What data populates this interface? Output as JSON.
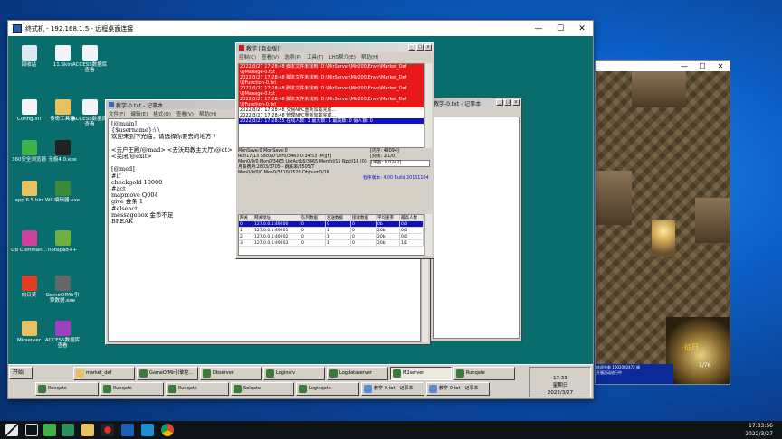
{
  "remote_window": {
    "title": "终式机 - 192.168.1.5 - 远程桌面连接",
    "min": "—",
    "max": "☐",
    "close": "✕"
  },
  "desktop_icons": [
    {
      "label": "回收站",
      "color": "#e0e8f0"
    },
    {
      "label": "11.Skin",
      "color": "#f4f4f4"
    },
    {
      "label": "ACCESS数据库查看",
      "color": "#f4f4f4"
    },
    {
      "label": "Config.ini",
      "color": "#f4f4f4"
    },
    {
      "label": "传奇工具箱",
      "color": "#e8c060"
    },
    {
      "label": "ACCESS数据库查看",
      "color": "#f4f4f4"
    },
    {
      "label": "360安全浏览器",
      "color": "#3fb24a"
    },
    {
      "label": "无极4.0.exe",
      "color": "#222222"
    },
    {
      "label": "app 6.5.bin",
      "color": "#e8c060"
    },
    {
      "label": "WIL编辑器.exe",
      "color": "#3a8a3a"
    },
    {
      "label": "DB Comman...",
      "color": "#d040a0"
    },
    {
      "label": "notepad++",
      "color": "#70b040"
    },
    {
      "label": "向日葵",
      "color": "#e04020"
    },
    {
      "label": "GameOfMir引擎数据.exe",
      "color": "#666666"
    },
    {
      "label": "Mirserver",
      "color": "#e8c060"
    },
    {
      "label": "ACCESS数据库查看",
      "color": "#a040c0"
    }
  ],
  "notepad": {
    "title": "教学-0.txt - 记事本",
    "menu": [
      "文件(F)",
      "编辑(E)",
      "格式(O)",
      "查看(V)",
      "帮助(H)"
    ],
    "content": "[@main]\n{$username}:\\ \\\n欢迎来到下光临，请选择你要去的地方 \\\n\n<去户王殿/@mad> <去沃玛教主大厅/@dt>\n<关闭/@exit>\n\n[@med]\n#if\ncheckgold 10000\n#act\nmapmove Q004\ngive 金条 1\n#elseact\nmessagebox 金币不足\nBREAK"
  },
  "back_window": {
    "title": "教学-0.txt - 记事本"
  },
  "server_window": {
    "title": "教学 [商业版]",
    "menu": [
      "控制(C)",
      "查看(V)",
      "选项(P)",
      "工具(T)",
      "LHS帮介(E)",
      "帮助(H)"
    ],
    "log": [
      {
        "text": "2022/3/27 17:28:48 脚本文件未找到: D:\\MirServer\\Mir200\\Envir\\Market_Def",
        "red": true
      },
      {
        "text": "\\QManage-0.txt",
        "red": true
      },
      {
        "text": "2022/3/27 17:28:48 脚本文件未找到: D:\\MirServer\\Mir200\\Envir\\Market_Def",
        "red": true
      },
      {
        "text": "\\QFunction-0.txt",
        "red": true
      },
      {
        "text": "2022/3/27 17:28:48 脚本文件未找到: D:\\MirServer\\Mir200\\Envir\\Market_Def",
        "red": true
      },
      {
        "text": "\\QManage-0.txt",
        "red": true
      },
      {
        "text": "2022/3/27 17:28:48 脚本文件未找到: D:\\MirServer\\Mir200\\Envir\\Market_Def",
        "red": true
      },
      {
        "text": "\\QFunction-0.txt",
        "red": true
      },
      {
        "text": "2022/3/27 17:28:48 交易NPC重新加载完成...",
        "red": false
      },
      {
        "text": "2022/3/27 17:28:48 管理NPC重新加载完成...",
        "red": false
      },
      {
        "text": "2022/3/27 17:28:55 在线人数: 1 最大数: 1 最高数: 0 假人数: 0",
        "red": false,
        "sel": true
      }
    ],
    "stats": [
      "MonSave:0 MonSave:0",
      "Run17/13 Soc0/0 Usr0/3465          0:34:53 [M][F]",
      "Mon0/0/0 Mon0/3465 UsrAct16/3465 MerchI/15 NpcI/16 (0)",
      "月薪费用:2803/3705 - 跳跃率/3505/T",
      "Mon0/0/0/0 Mon0/3310/3520 Objhum0/16"
    ],
    "right_stats": [
      "[内存: 49094]",
      "[刻线: 1/1/0]",
      "[带宽: 0.0242]"
    ],
    "version": "程序版本: 4.00 Build 20151104",
    "grid_headers": [
      "网关",
      "网关地址",
      "队列数据",
      "发送数据",
      "接收数据",
      "平均速率",
      "最高人数"
    ],
    "grid_rows": [
      [
        "0",
        "127.0.0.1:49200",
        "0",
        "0",
        "0",
        "0b",
        "0/0"
      ],
      [
        "1",
        "127.0.0.1:49201",
        "0",
        "1",
        "0",
        "20b",
        "0/0"
      ],
      [
        "2",
        "127.0.0.1:49202",
        "0",
        "1",
        "0",
        "20b",
        "0/0"
      ],
      [
        "3",
        "127.0.0.1:49203",
        "0",
        "1",
        "0",
        "20b",
        "1/1"
      ]
    ]
  },
  "inner_taskbar": {
    "start": "开始",
    "row1": [
      "market_def",
      "GameOfMir引擎控...",
      "Dbserver",
      "Loginsrv",
      "Logdataserver",
      "M2server",
      "Runqate"
    ],
    "row2": [
      "Runqate",
      "Runqate",
      "Runqate",
      "Selqate",
      "Loginqate",
      "教学-0.txt - 记事本",
      "教学-0.txt - 记事本"
    ],
    "clock_time": "17:33",
    "clock_day": "星期日",
    "clock_date": "2022/3/27"
  },
  "game": {
    "name": "征日",
    "level": "1/76",
    "chat": [
      "欢迎光临 1002002472 服",
      "开服活动进行中"
    ]
  },
  "host_taskbar": {
    "time": "17:33:56",
    "date": "2022/3/27"
  }
}
